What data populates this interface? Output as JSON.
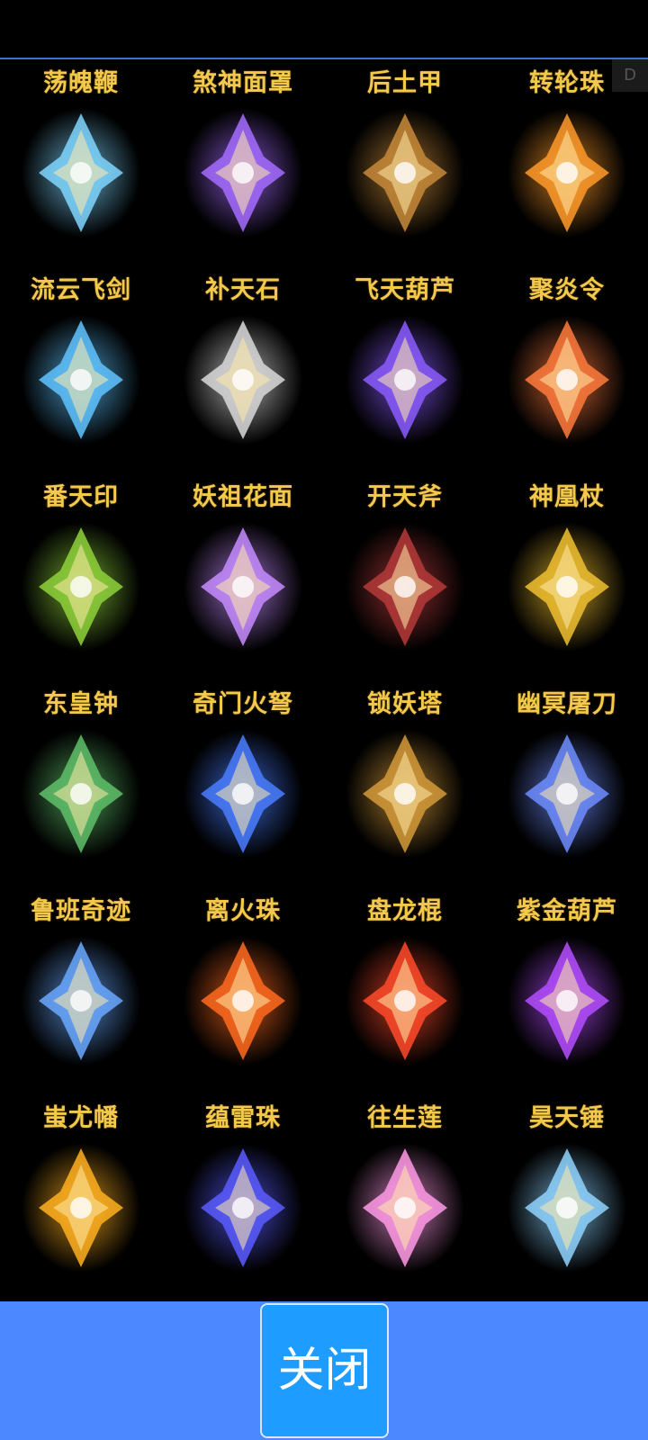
{
  "corner_tab": {
    "label": "D"
  },
  "items": [
    {
      "name": "荡魄鞭",
      "icon": "blue-whip-icon",
      "color": "#7fd6ff"
    },
    {
      "name": "煞神面罩",
      "icon": "purple-mask-icon",
      "color": "#a46cff"
    },
    {
      "name": "后土甲",
      "icon": "bronze-armor-icon",
      "color": "#c7893a"
    },
    {
      "name": "转轮珠",
      "icon": "fire-wheel-icon",
      "color": "#ff9a2a"
    },
    {
      "name": "流云飞剑",
      "icon": "cloud-sword-icon",
      "color": "#5fc3ff"
    },
    {
      "name": "补天石",
      "icon": "silver-orb-icon",
      "color": "#d9d9d9"
    },
    {
      "name": "飞天葫芦",
      "icon": "violet-gourd-icon",
      "color": "#8b5cff"
    },
    {
      "name": "聚炎令",
      "icon": "flame-token-icon",
      "color": "#ff7a3d"
    },
    {
      "name": "番天印",
      "icon": "jade-seal-icon",
      "color": "#8ed13b"
    },
    {
      "name": "妖祖花面",
      "icon": "flower-mask-icon",
      "color": "#c58cff"
    },
    {
      "name": "开天斧",
      "icon": "dark-axe-icon",
      "color": "#b53a3a"
    },
    {
      "name": "神凰杖",
      "icon": "phoenix-staff-icon",
      "color": "#f0c030"
    },
    {
      "name": "东皇钟",
      "icon": "jade-bell-icon",
      "color": "#5fbf6a"
    },
    {
      "name": "奇门火弩",
      "icon": "fire-crossbow-icon",
      "color": "#4a7dff"
    },
    {
      "name": "锁妖塔",
      "icon": "pagoda-icon",
      "color": "#d49a3a"
    },
    {
      "name": "幽冥屠刀",
      "icon": "ghost-blade-icon",
      "color": "#6f8dff"
    },
    {
      "name": "鲁班奇迹",
      "icon": "blue-flame-relic-icon",
      "color": "#6aa8ff"
    },
    {
      "name": "离火珠",
      "icon": "fire-pearl-icon",
      "color": "#ff6a1f"
    },
    {
      "name": "盘龙棍",
      "icon": "dragon-staff-icon",
      "color": "#ff4a2a"
    },
    {
      "name": "紫金葫芦",
      "icon": "purple-gold-gourd-icon",
      "color": "#b44dff"
    },
    {
      "name": "蚩尤幡",
      "icon": "golden-banner-icon",
      "color": "#ffb020"
    },
    {
      "name": "蕴雷珠",
      "icon": "thunder-orb-icon",
      "color": "#5a5cff"
    },
    {
      "name": "往生莲",
      "icon": "lotus-icon",
      "color": "#ff9ae6"
    },
    {
      "name": "昊天锤",
      "icon": "sky-hammer-icon",
      "color": "#8fd3ff"
    }
  ],
  "footer": {
    "close_label": "关闭"
  }
}
